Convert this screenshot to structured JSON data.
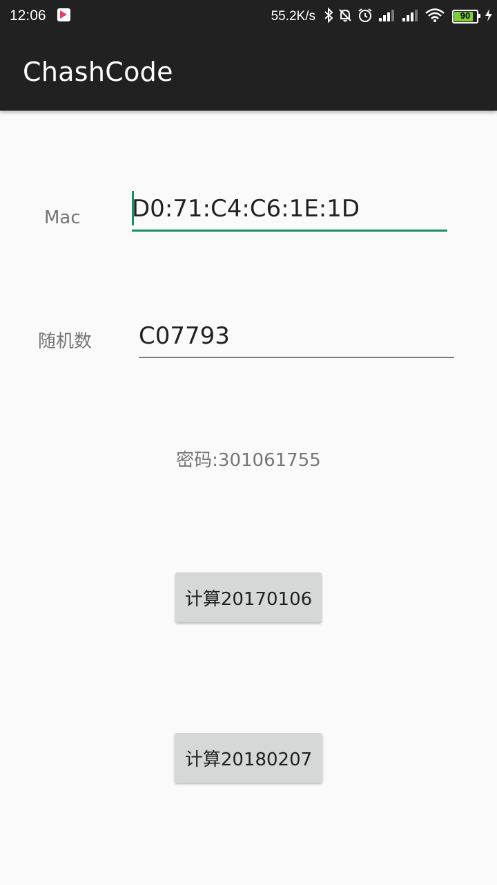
{
  "status_bar": {
    "time": "12:06",
    "net_speed": "55.2K/s",
    "battery_level": "90",
    "icons": [
      "app-notification-icon",
      "bluetooth-icon",
      "mute-icon",
      "alarm-icon",
      "signal-icon",
      "signal-icon",
      "wifi-icon",
      "battery-icon",
      "charging-icon"
    ]
  },
  "toolbar": {
    "title": "ChashCode"
  },
  "form": {
    "mac_label": "Mac",
    "mac_value": "D0:71:C4:C6:1E:1D",
    "random_label": "随机数",
    "random_value": "C07793"
  },
  "result": {
    "password_text": "密码:301061755"
  },
  "buttons": {
    "calc_2017": "计算20170106",
    "calc_2018": "计算20180207"
  },
  "colors": {
    "toolbar_bg": "#212121",
    "accent": "#148f68",
    "button_bg": "#d6d7d7"
  }
}
